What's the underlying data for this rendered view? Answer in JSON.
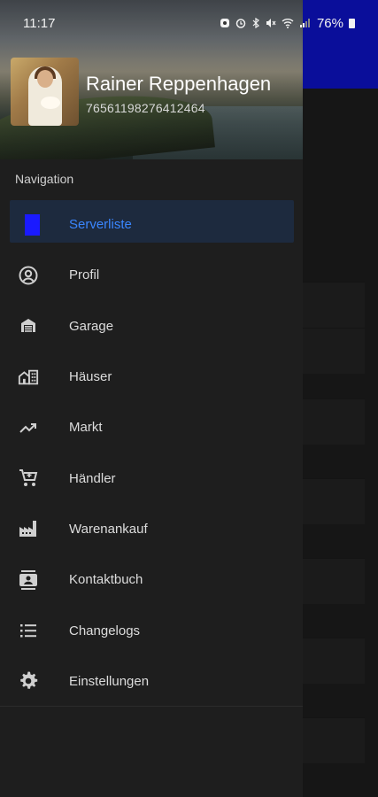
{
  "status_bar": {
    "time": "11:17",
    "battery": "76%",
    "icons": [
      "notification-icon",
      "alarm-icon",
      "bluetooth-icon",
      "mute-icon",
      "wifi-icon",
      "signal-icon",
      "battery-icon"
    ]
  },
  "profile": {
    "name": "Rainer Reppenhagen",
    "id": "76561198276412464"
  },
  "nav": {
    "section_title": "Navigation",
    "items": [
      {
        "label": "Serverliste",
        "icon": "server-list-icon",
        "active": true
      },
      {
        "label": "Profil",
        "icon": "account-circle-icon",
        "active": false
      },
      {
        "label": "Garage",
        "icon": "garage-icon",
        "active": false
      },
      {
        "label": "Häuser",
        "icon": "houses-icon",
        "active": false
      },
      {
        "label": "Markt",
        "icon": "trending-up-icon",
        "active": false
      },
      {
        "label": "Händler",
        "icon": "shopping-cart-icon",
        "active": false
      },
      {
        "label": "Warenankauf",
        "icon": "factory-icon",
        "active": false
      },
      {
        "label": "Kontaktbuch",
        "icon": "contacts-icon",
        "active": false
      },
      {
        "label": "Changelogs",
        "icon": "list-icon",
        "active": false
      },
      {
        "label": "Einstellungen",
        "icon": "settings-icon",
        "active": false
      }
    ]
  },
  "colors": {
    "accent": "#3a86ff",
    "app_bar": "#0a0e9a",
    "active_item_bg": "#1d2a3e",
    "drawer_bg": "#1e1e1e"
  }
}
